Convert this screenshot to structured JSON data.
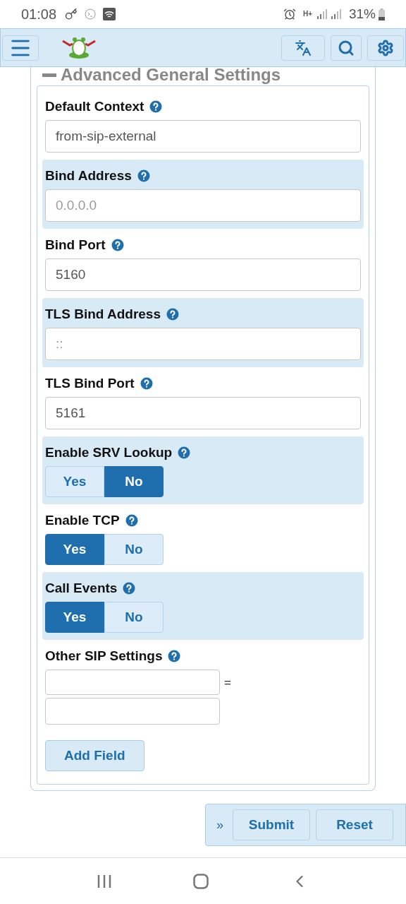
{
  "status_bar": {
    "time": "01:08",
    "network": "H+",
    "battery": "31%"
  },
  "section": {
    "title": "Advanced General Settings",
    "expanded": true
  },
  "fields": [
    {
      "kind": "text",
      "label": "Default Context",
      "value": "from-sip-external",
      "shaded": false
    },
    {
      "kind": "text",
      "label": "Bind Address",
      "placeholder": "0.0.0.0",
      "shaded": true
    },
    {
      "kind": "text",
      "label": "Bind Port",
      "value": "5160",
      "shaded": false
    },
    {
      "kind": "text",
      "label": "TLS Bind Address",
      "placeholder": "::",
      "shaded": true
    },
    {
      "kind": "text",
      "label": "TLS Bind Port",
      "value": "5161",
      "shaded": false
    },
    {
      "kind": "toggle",
      "label": "Enable SRV Lookup",
      "shaded": true,
      "options": [
        {
          "label": "Yes",
          "selected": false
        },
        {
          "label": "No",
          "selected": true
        }
      ]
    },
    {
      "kind": "toggle",
      "label": "Enable TCP",
      "shaded": false,
      "options": [
        {
          "label": "Yes",
          "selected": true
        },
        {
          "label": "No",
          "selected": false
        }
      ]
    },
    {
      "kind": "toggle",
      "label": "Call Events",
      "shaded": true,
      "options": [
        {
          "label": "Yes",
          "selected": true
        },
        {
          "label": "No",
          "selected": false
        }
      ]
    },
    {
      "kind": "keyvalue",
      "label": "Other SIP Settings",
      "separator": "=",
      "shaded": false
    }
  ],
  "add_button": "Add Field",
  "footer": {
    "expand": "»",
    "buttons": [
      "Submit",
      "Reset"
    ]
  }
}
